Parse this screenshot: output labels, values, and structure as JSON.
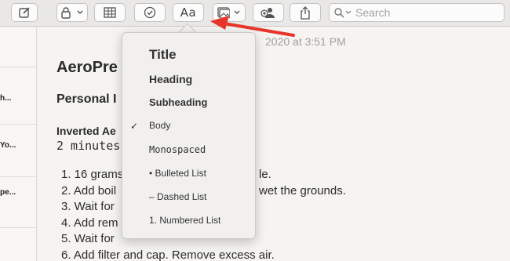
{
  "toolbar": {
    "format_label": "Aa",
    "search_placeholder": "Search"
  },
  "sidebar": {
    "items": [
      {
        "label": "h..."
      },
      {
        "label": "Yo..."
      },
      {
        "label": "pe..."
      }
    ]
  },
  "note": {
    "date": "2020 at 3:51 PM",
    "title": "AeroPre",
    "heading": "Personal I",
    "subheading": "Inverted Ae",
    "mono": "2 minutes",
    "list": [
      "1. 16 grams",
      "2. Add boil",
      "3. Wait for",
      "4. Add rem",
      "5. Wait for",
      "6. Add filter and cap. Remove excess air."
    ],
    "fragment_1": "le.",
    "fragment_2": "wet the grounds."
  },
  "menu": {
    "items": [
      {
        "label": "Title"
      },
      {
        "label": "Heading"
      },
      {
        "label": "Subheading"
      },
      {
        "label": "Body",
        "checked": true
      },
      {
        "label": "Monospaced"
      },
      {
        "label": "• Bulleted List"
      },
      {
        "label": "– Dashed List"
      },
      {
        "label": "1. Numbered List"
      }
    ],
    "check_mark": "✓"
  },
  "colors": {
    "arrow": "#e8352b",
    "accent": "#3c3c3c"
  }
}
